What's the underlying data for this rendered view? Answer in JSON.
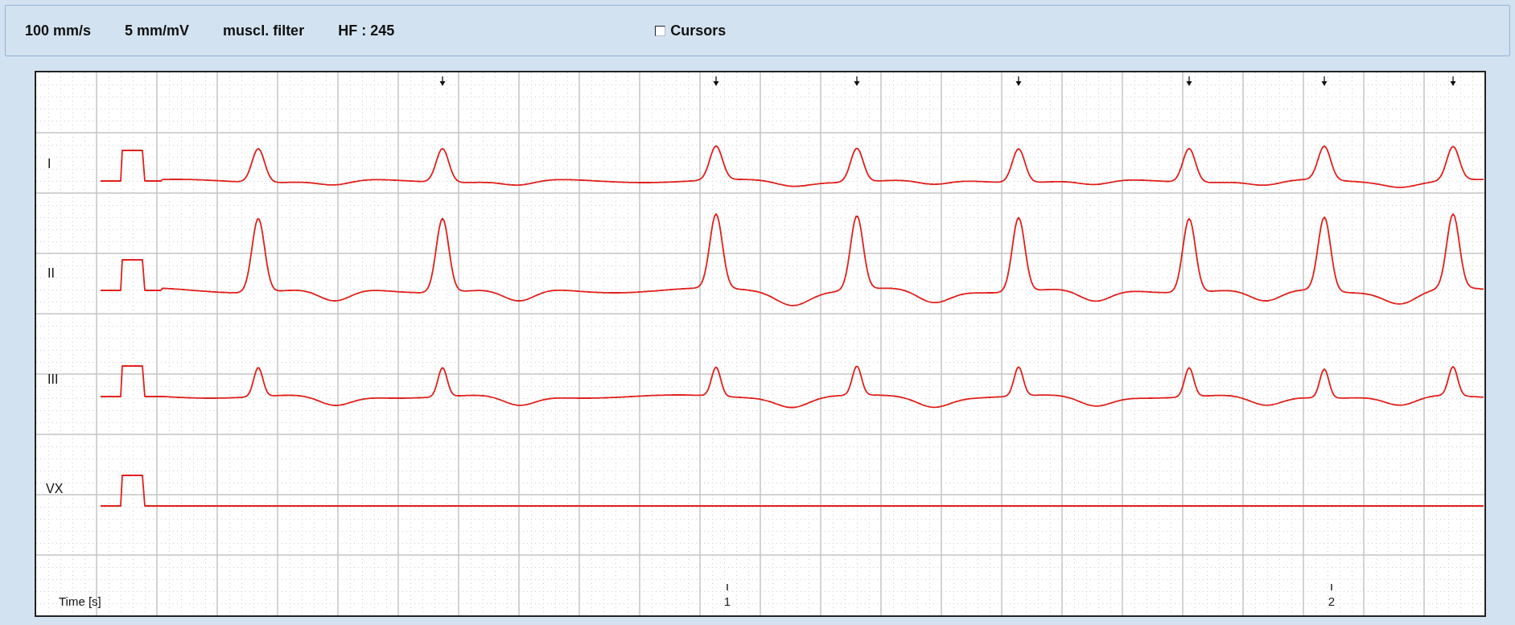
{
  "toolbar": {
    "items": [
      "100 mm/s",
      "5 mm/mV",
      "muscl. filter",
      "HF : 245"
    ],
    "cursors": {
      "label": "Cursors",
      "checked": false
    }
  },
  "ecg": {
    "leads": [
      {
        "label": "I"
      },
      {
        "label": "II"
      },
      {
        "label": "III"
      },
      {
        "label": "VX"
      }
    ],
    "time_label": "Time [s]",
    "time_ticks": [
      "1",
      "2"
    ]
  }
}
